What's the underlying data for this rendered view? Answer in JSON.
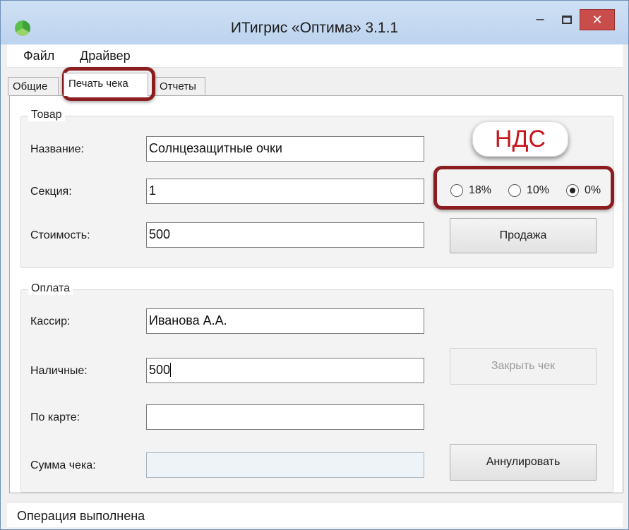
{
  "window": {
    "title": "ИТигрис «Оптима» 3.1.1",
    "minimize": "–",
    "close": "✕"
  },
  "menu": {
    "items": [
      "Файл",
      "Драйвер"
    ]
  },
  "tabs": [
    "Общие",
    "Печать чека",
    "Отчеты"
  ],
  "active_tab": "Печать чека",
  "goods": {
    "legend": "Товар",
    "name_label": "Название:",
    "name_value": "Солнцезащитные очки",
    "section_label": "Секция:",
    "section_value": "1",
    "cost_label": "Стоимость:",
    "cost_value": "500",
    "sale_button": "Продажа",
    "vat_options": [
      {
        "label": "18%",
        "checked": false
      },
      {
        "label": "10%",
        "checked": false
      },
      {
        "label": "0%",
        "checked": true
      }
    ]
  },
  "payment": {
    "legend": "Оплата",
    "cashier_label": "Кассир:",
    "cashier_value": "Иванова А.А.",
    "cash_label": "Наличные:",
    "cash_value": "500",
    "card_label": "По карте:",
    "card_value": "",
    "total_label": "Сумма чека:",
    "total_value": "",
    "close_check_button": "Закрыть чек",
    "cancel_button": "Аннулировать"
  },
  "annotation": {
    "callout": "НДС",
    "color": "#8b1c20",
    "text_color": "#c4161c"
  },
  "status": {
    "text": "Операция выполнена"
  },
  "colors": {
    "close_button": "#c94d4b",
    "titlebar": "#bcd3ee"
  }
}
